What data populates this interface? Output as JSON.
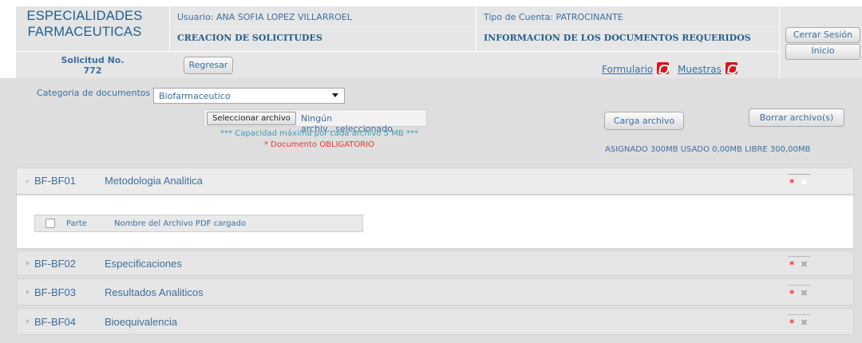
{
  "header": {
    "brand_line1": "ESPECIALIDADES",
    "brand_line2": "FARMACEUTICAS",
    "user_label": "Usuario: ANA SOFIA LOPEZ VILLARROEL",
    "module_title": "CREACION DE SOLICITUDES",
    "account_type": "Tipo de Cuenta: PATROCINANTE",
    "section_title": "INFORMACION DE LOS DOCUMENTOS REQUERIDOS",
    "request_label": "Solicitud No.",
    "request_number": "772",
    "back_button": "Regresar",
    "form_link": "Formulario",
    "samples_link": "Muestras",
    "logout_button": "Cerrar Sesión",
    "home_button": "Inicio"
  },
  "upload": {
    "category_label": "Categoria de documentos",
    "category_value": "Biofarmaceutico",
    "file_button": "Seleccionar archivo",
    "file_status": "Ningún archiv...seleccionado",
    "capacity_note": "*** Capacidad máxima por cada archivo 5 MB ***",
    "required_note": "* Documento OBLIGATORIO",
    "upload_button": "Carga archivo",
    "delete_button": "Borrar archivo(s)",
    "quota": "ASIGNADO 300MB USADO 0,00MB LIBRE 300,00MB"
  },
  "sections": [
    {
      "code": "BF-BF01",
      "title": "Metodologia Analitica",
      "expanded": true
    },
    {
      "code": "BF-BF02",
      "title": "Especificaciones",
      "expanded": false
    },
    {
      "code": "BF-BF03",
      "title": "Resultados Analiticos",
      "expanded": false
    },
    {
      "code": "BF-BF04",
      "title": "Bioequivalencia",
      "expanded": false
    }
  ],
  "table": {
    "col_part": "Parte",
    "col_name": "Nombre del Archivo PDF cargado"
  },
  "colors": {
    "brand_blue": "#1f5f8f",
    "link_blue": "#3b6fa0",
    "required_red": "#e33333",
    "header_gray": "#e6e6e6",
    "body_gray": "#dedede"
  }
}
